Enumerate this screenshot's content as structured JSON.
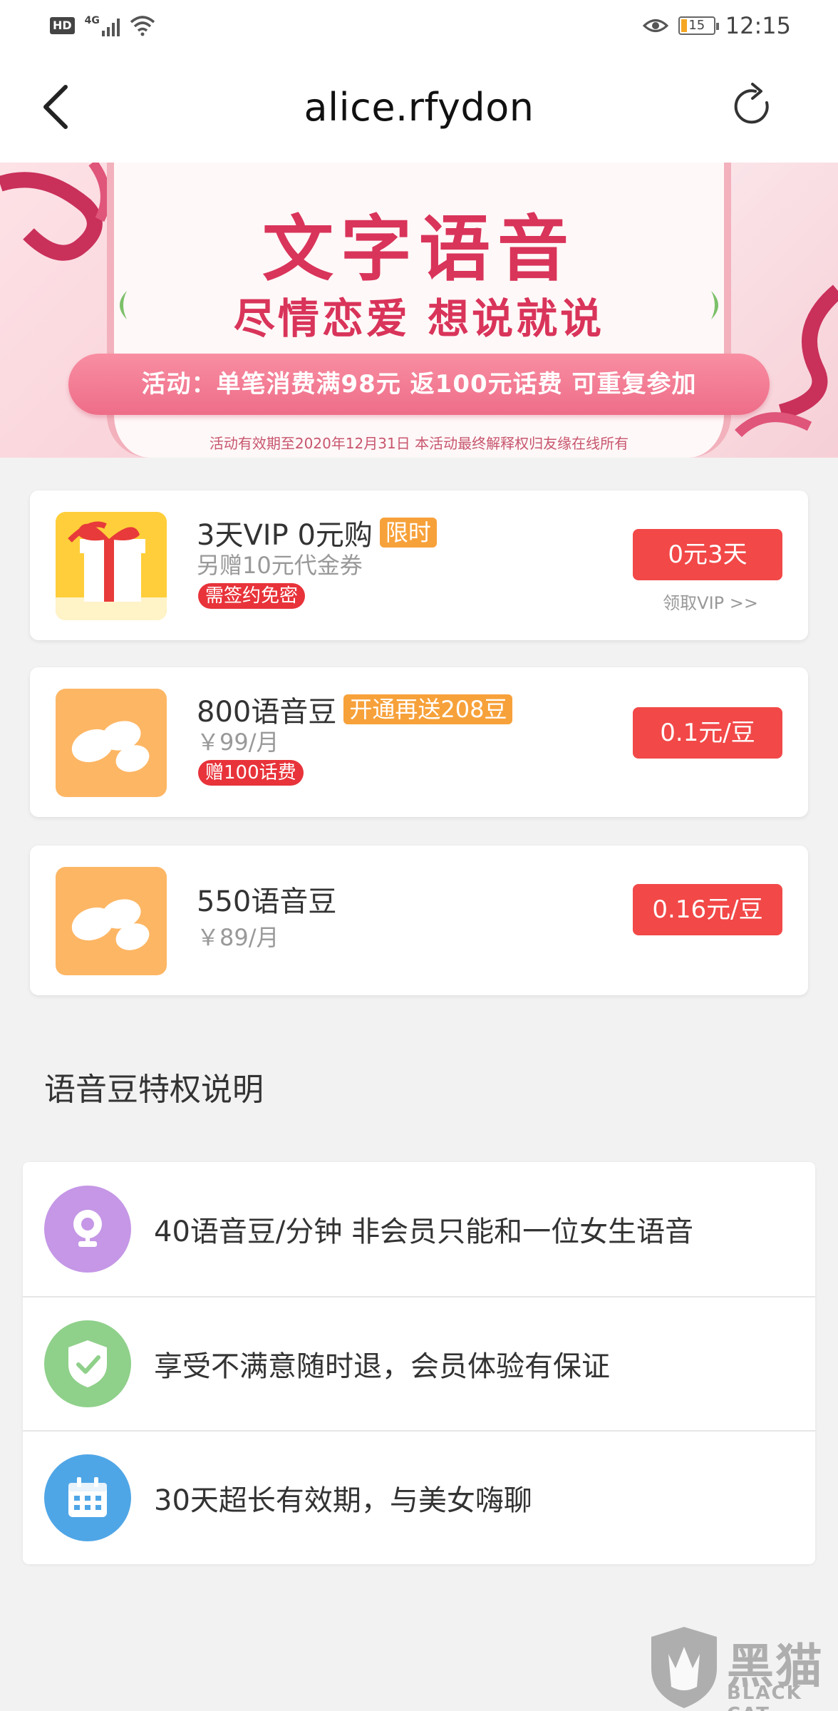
{
  "status_bar": {
    "hd": "HD",
    "network": "4G",
    "battery": "15",
    "time": "12:15"
  },
  "nav": {
    "title": "alice.rfydon"
  },
  "banner": {
    "title": "文字语音",
    "subtitle": "尽情恋爱 想说就说",
    "promo": "活动：单笔消费满98元 返100元话费 可重复参加",
    "note": "活动有效期至2020年12月31日 本活动最终解释权归友缘在线所有"
  },
  "offers": [
    {
      "title": "3天VIP 0元购",
      "tag": "限时",
      "subtitle": "另赠10元代金券",
      "badge": "需签约免密",
      "price": "0元3天",
      "link": "领取VIP >>"
    },
    {
      "title": "800语音豆",
      "tag": "开通再送208豆",
      "subtitle": "￥99/月",
      "badge": "赠100话费",
      "price": "0.1元/豆"
    },
    {
      "title": "550语音豆",
      "subtitle": "￥89/月",
      "price": "0.16元/豆"
    }
  ],
  "privileges": {
    "section_title": "语音豆特权说明",
    "items": [
      {
        "text": "40语音豆/分钟 非会员只能和一位女生语音",
        "icon": "webcam-icon",
        "color": "#c597e6"
      },
      {
        "text": "享受不满意随时退，会员体验有保证",
        "icon": "shield-check-icon",
        "color": "#8fd08a"
      },
      {
        "text": "30天超长有效期，与美女嗨聊",
        "icon": "calendar-icon",
        "color": "#4fa6e6"
      }
    ]
  },
  "watermark": {
    "title": "黑猫",
    "subtitle": "BLACK CAT"
  },
  "colors": {
    "accent_red": "#f24848",
    "tag_orange": "#f7a13a",
    "banner_pink": "#d9345a"
  }
}
